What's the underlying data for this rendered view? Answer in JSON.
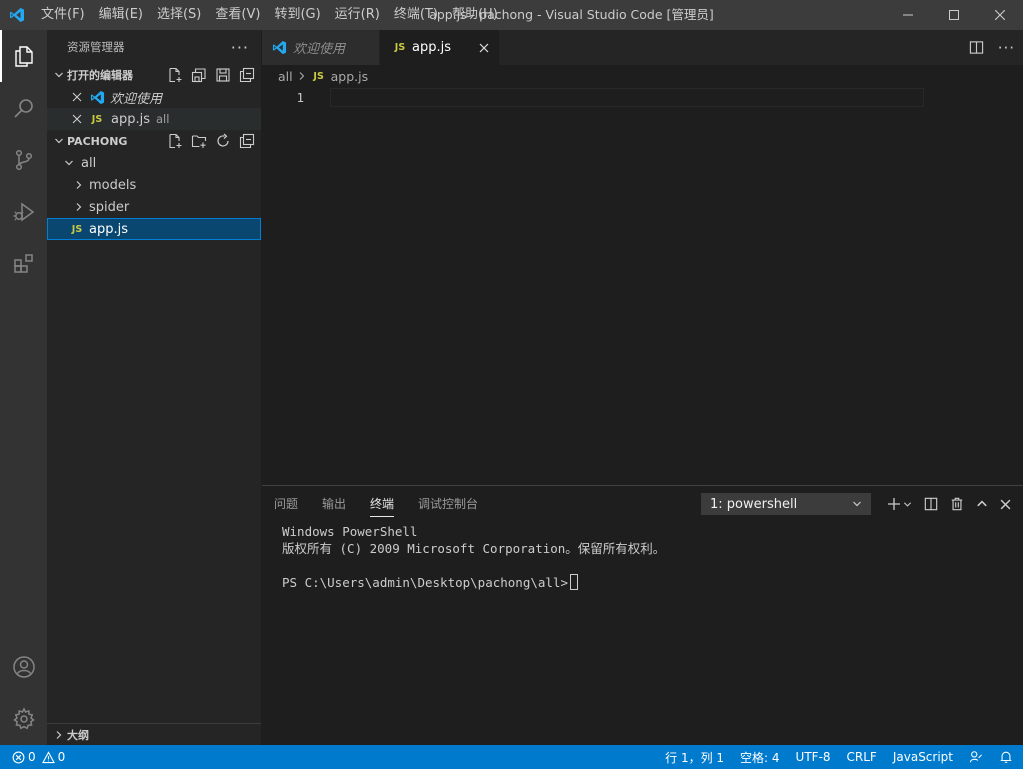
{
  "window": {
    "title": "app.js - pachong - Visual Studio Code [管理员]",
    "menu": [
      "文件(F)",
      "编辑(E)",
      "选择(S)",
      "查看(V)",
      "转到(G)",
      "运行(R)",
      "终端(T)",
      "帮助(H)"
    ]
  },
  "activitybar": {
    "items": [
      "files-icon",
      "search-icon",
      "source-control-icon",
      "run-debug-icon",
      "extensions-icon"
    ],
    "bottom": [
      "account-icon",
      "settings-gear-icon"
    ]
  },
  "sidebar": {
    "title": "资源管理器",
    "more": "···",
    "open_editors": {
      "header": "打开的编辑器",
      "items": [
        {
          "label": "欢迎使用",
          "desc": ""
        },
        {
          "label": "app.js",
          "desc": "all",
          "badge": "JS"
        }
      ]
    },
    "project": {
      "header": "PACHONG",
      "tree": [
        {
          "label": "all"
        },
        {
          "label": "models"
        },
        {
          "label": "spider"
        },
        {
          "label": "app.js",
          "badge": "JS"
        }
      ]
    },
    "outline": {
      "header": "大纲"
    }
  },
  "editor": {
    "tabs": [
      {
        "label": "欢迎使用",
        "active": false
      },
      {
        "label": "app.js",
        "badge": "JS",
        "active": true
      }
    ],
    "breadcrumb": {
      "folder": "all",
      "file": "app.js",
      "badge": "JS"
    },
    "line_numbers": [
      "1"
    ]
  },
  "panel": {
    "tabs": [
      "问题",
      "输出",
      "终端",
      "调试控制台"
    ],
    "active_tab": "终端",
    "terminal_select": "1: powershell",
    "terminal_lines": [
      "Windows PowerShell",
      "版权所有 (C) 2009 Microsoft Corporation。保留所有权利。",
      "",
      "PS C:\\Users\\admin\\Desktop\\pachong\\all>"
    ]
  },
  "statusbar": {
    "errors": "0",
    "warnings": "0",
    "position": "行 1，列 1",
    "spaces": "空格: 4",
    "encoding": "UTF-8",
    "eol": "CRLF",
    "language": "JavaScript"
  },
  "colors": {
    "accent": "#007acc",
    "selection": "#094771",
    "js_badge": "#cbcb41",
    "vscode_blue": "#23a9f2"
  }
}
